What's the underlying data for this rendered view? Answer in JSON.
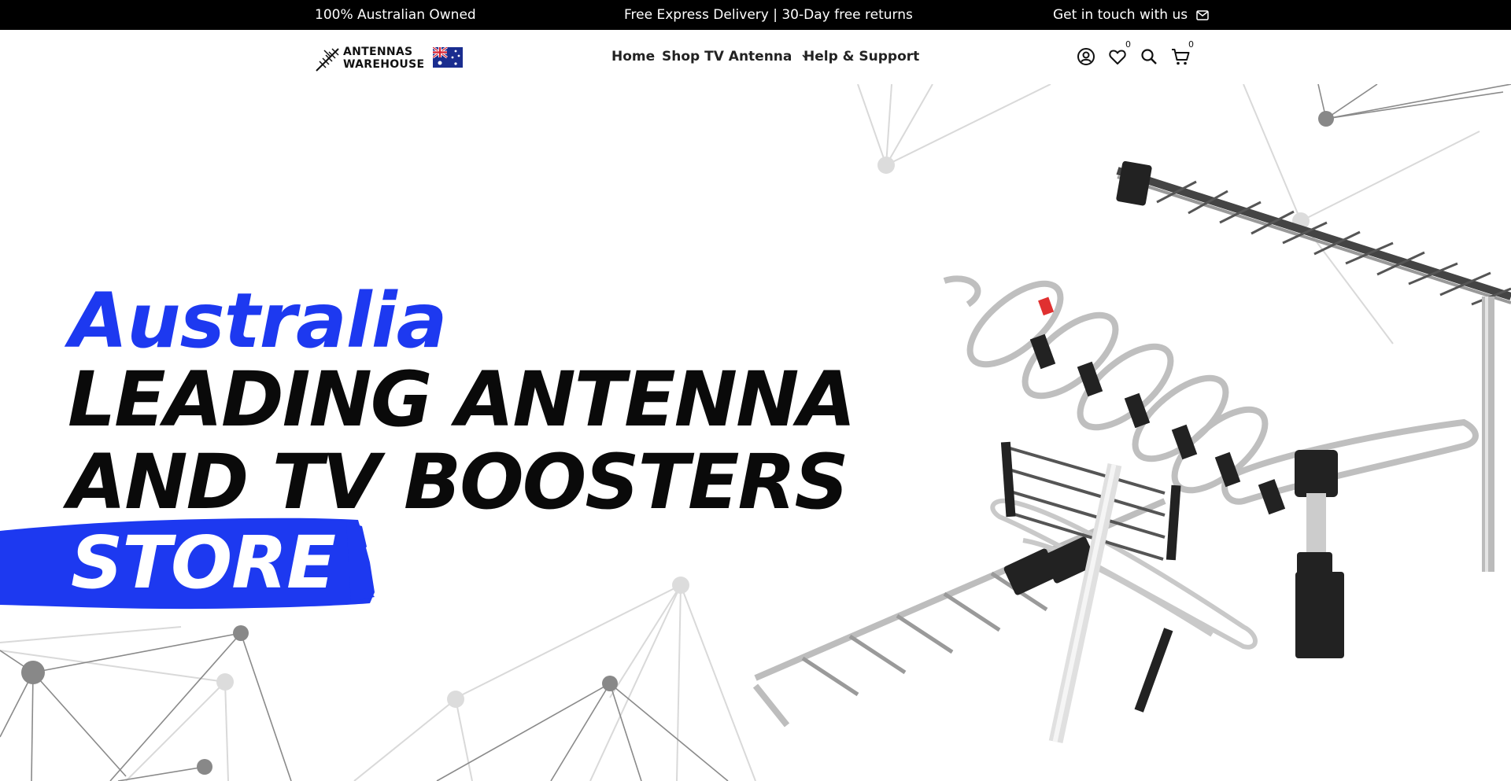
{
  "topbar": {
    "left": "100% Australian Owned",
    "center": "Free Express Delivery | 30-Day free returns",
    "right": "Get in touch with us",
    "right_icon": "mail-icon"
  },
  "brand": {
    "name_line1": "ANTENNAS",
    "name_line2": "WAREHOUSE",
    "flag": "australian-flag"
  },
  "nav": {
    "items": [
      {
        "label": "Home"
      },
      {
        "label": "Shop TV Antenna",
        "dropdown": true
      },
      {
        "label": "Help & Support"
      }
    ]
  },
  "header_icons": {
    "account": "account-icon",
    "wishlist": "heart-icon",
    "wishlist_count": "0",
    "search": "search-icon",
    "cart": "cart-icon",
    "cart_count": "0"
  },
  "hero": {
    "line1": "Australia",
    "line2": "LEADING ANTENNA",
    "line3": "AND TV BOOSTERS",
    "line4": "STORE",
    "accent_color": "#1d39f0"
  }
}
